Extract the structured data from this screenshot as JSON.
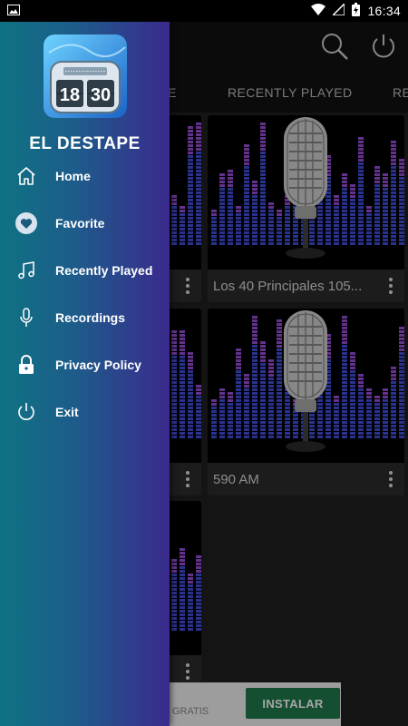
{
  "status_bar": {
    "time": "16:34"
  },
  "app_bar": {
    "tabs": [
      "E",
      "RECENTLY PLAYED",
      "RE"
    ]
  },
  "cards": [
    {
      "title": ""
    },
    {
      "title": "Los 40 Principales 105..."
    },
    {
      "title": ""
    },
    {
      "title": "590 AM"
    },
    {
      "title": ""
    }
  ],
  "ad": {
    "text": "GRATIS",
    "install_label": "INSTALAR"
  },
  "drawer": {
    "logo_digits": [
      "18",
      "30"
    ],
    "title": "EL DESTAPE",
    "items": [
      {
        "label": "Home",
        "icon": "home-icon"
      },
      {
        "label": "Favorite",
        "icon": "heart-icon"
      },
      {
        "label": "Recently Played",
        "icon": "music-note-icon"
      },
      {
        "label": "Recordings",
        "icon": "microphone-icon"
      },
      {
        "label": "Privacy Policy",
        "icon": "lock-icon"
      },
      {
        "label": "Exit",
        "icon": "power-icon"
      }
    ]
  },
  "colors": {
    "drawer_gradient_start": "#0e7382",
    "drawer_gradient_end": "#3a2a8c",
    "install_button": "#1f7a4d",
    "equalizer": "#4b5cff"
  }
}
